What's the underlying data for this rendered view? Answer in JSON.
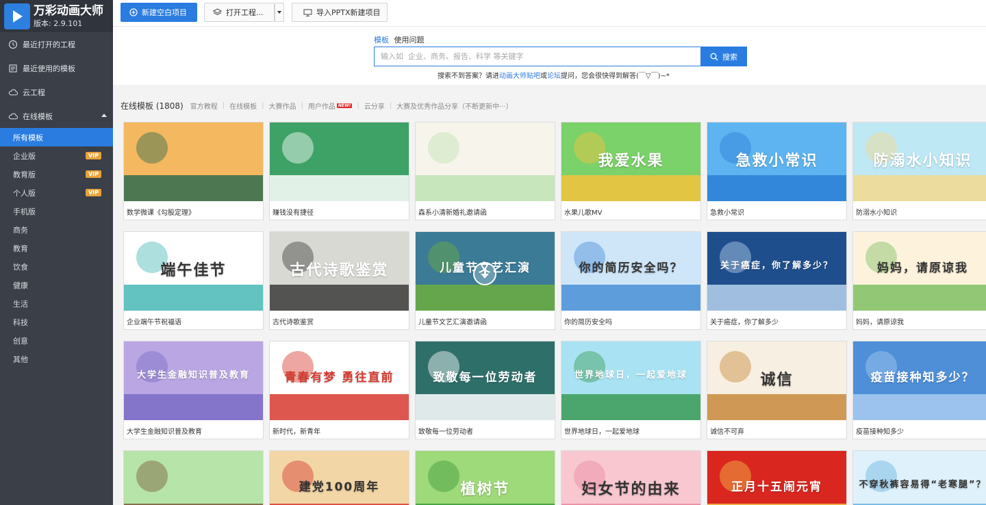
{
  "app": {
    "title": "万彩动画大师",
    "version": "版本: 2.9.101"
  },
  "sidebar": {
    "nav": [
      {
        "label": "最近打开的工程",
        "icon": "clock-icon"
      },
      {
        "label": "最近使用的模板",
        "icon": "template-icon"
      },
      {
        "label": "云工程",
        "icon": "cloud-icon"
      },
      {
        "label": "在线模板",
        "icon": "cloud-icon",
        "expanded": true
      }
    ],
    "categories": [
      {
        "label": "所有模板",
        "active": true
      },
      {
        "label": "企业版",
        "vip": "VIP"
      },
      {
        "label": "教育版",
        "vip": "VIP"
      },
      {
        "label": "个人版",
        "vip": "VIP"
      },
      {
        "label": "手机版"
      },
      {
        "label": "商务"
      },
      {
        "label": "教育"
      },
      {
        "label": "饮食"
      },
      {
        "label": "健康"
      },
      {
        "label": "生活"
      },
      {
        "label": "科技"
      },
      {
        "label": "创意"
      },
      {
        "label": "其他"
      }
    ]
  },
  "toolbar": {
    "new_blank": "新建空白项目",
    "open_project": "打开工程...",
    "import_ppt": "导入PPTX新建项目"
  },
  "search": {
    "tab_templates": "模板",
    "tab_questions": "使用问题",
    "placeholder": "输入如  企业、商务、报告、科学 等关键字",
    "button": "搜索",
    "hint_pre": "搜索不到答案？请进",
    "hint_link1": "动画大师贴吧",
    "hint_mid": "或",
    "hint_link2": "论坛",
    "hint_post": "提问，您会很快得到解答(￣▽￣)~*"
  },
  "filters": {
    "heading": "在线模板 (1808)",
    "items": [
      "官方教程",
      "在线模板",
      "大赛作品",
      "用户作品",
      "云分享",
      "大赛及优秀作品分享（不断更新中···）"
    ],
    "new_badge": "NEW!"
  },
  "templates": [
    {
      "title": "数学微课《勾股定理》",
      "bg": "#f4b860",
      "bg2": "#2f6b4f",
      "art": ""
    },
    {
      "title": "赚钱没有捷径",
      "bg": "#3ea267",
      "bg2": "#ffffff",
      "art": ""
    },
    {
      "title": "森系小清新婚礼邀请函",
      "bg": "#f7f4ec",
      "bg2": "#bfe3b4",
      "art": ""
    },
    {
      "title": "水果儿歌MV",
      "bg": "#7bd16a",
      "bg2": "#f6c33d",
      "art": "我爱水果"
    },
    {
      "title": "急救小常识",
      "bg": "#5db4f0",
      "bg2": "#2c7fd6",
      "art": "急救小常识"
    },
    {
      "title": "防溺水小知识",
      "bg": "#bfe8f5",
      "bg2": "#f3d98e",
      "art": "防溺水小知识"
    },
    {
      "title": "企业端午节祝福语",
      "bg": "#ffffff",
      "bg2": "#46b9b5",
      "art": "端午佳节"
    },
    {
      "title": "古代诗歌鉴赏",
      "bg": "#d9d9d4",
      "bg2": "#3b3b3b",
      "art": "古代诗歌鉴赏"
    },
    {
      "title": "儿童节文艺汇演邀请函",
      "bg": "#3b7b96",
      "bg2": "#6dae3f",
      "art": "儿童节文艺汇演"
    },
    {
      "title": "你的简历安全吗",
      "bg": "#cfe6f8",
      "bg2": "#4a8fd6",
      "art": "你的简历安全吗？"
    },
    {
      "title": "关于癌症，你了解多少",
      "bg": "#1f4e8c",
      "bg2": "#b7d4ee",
      "art": "关于癌症，你了解多少？"
    },
    {
      "title": "妈妈，请原谅我",
      "bg": "#fdf3dd",
      "bg2": "#7fbf63",
      "art": "妈妈，请原谅我"
    },
    {
      "title": "大学生金融知识普及教育",
      "bg": "#b9a6e3",
      "bg2": "#7b6cc5",
      "art": "大学生金融知识普及教育"
    },
    {
      "title": "新时代，新青年",
      "bg": "#ffffff",
      "bg2": "#d73a2f",
      "art": "青春有梦 勇往直前"
    },
    {
      "title": "致敬每一位劳动者",
      "bg": "#2f6f6a",
      "bg2": "#ffffff",
      "art": "致敬每一位劳动者"
    },
    {
      "title": "世界地球日，一起爱地球",
      "bg": "#a9e3f3",
      "bg2": "#3a9b54",
      "art": "世界地球日，一起爱地球"
    },
    {
      "title": "诚信不可弃",
      "bg": "#f7efe1",
      "bg2": "#c8893c",
      "art": "诚信"
    },
    {
      "title": "疫苗接种知多少",
      "bg": "#4e8fd8",
      "bg2": "#a9cdf2",
      "art": "疫苗接种知多少？"
    },
    {
      "title": "",
      "bg": "#b7e4a8",
      "bg2": "#7a5a3a",
      "art": ""
    },
    {
      "title": "",
      "bg": "#f3d6a6",
      "bg2": "#d73a2f",
      "art": "建党100周年"
    },
    {
      "title": "",
      "bg": "#9ed97a",
      "bg2": "#3d9a3a",
      "art": "植树节"
    },
    {
      "title": "",
      "bg": "#f9c7d0",
      "bg2": "#e98aa0",
      "art": "妇女节的由来"
    },
    {
      "title": "",
      "bg": "#d9261f",
      "bg2": "#f3c24a",
      "art": "正月十五闹元宵"
    },
    {
      "title": "",
      "bg": "#dff1fb",
      "bg2": "#6ab3e0",
      "art": "不穿秋裤容易得“老寒腿”？"
    }
  ]
}
